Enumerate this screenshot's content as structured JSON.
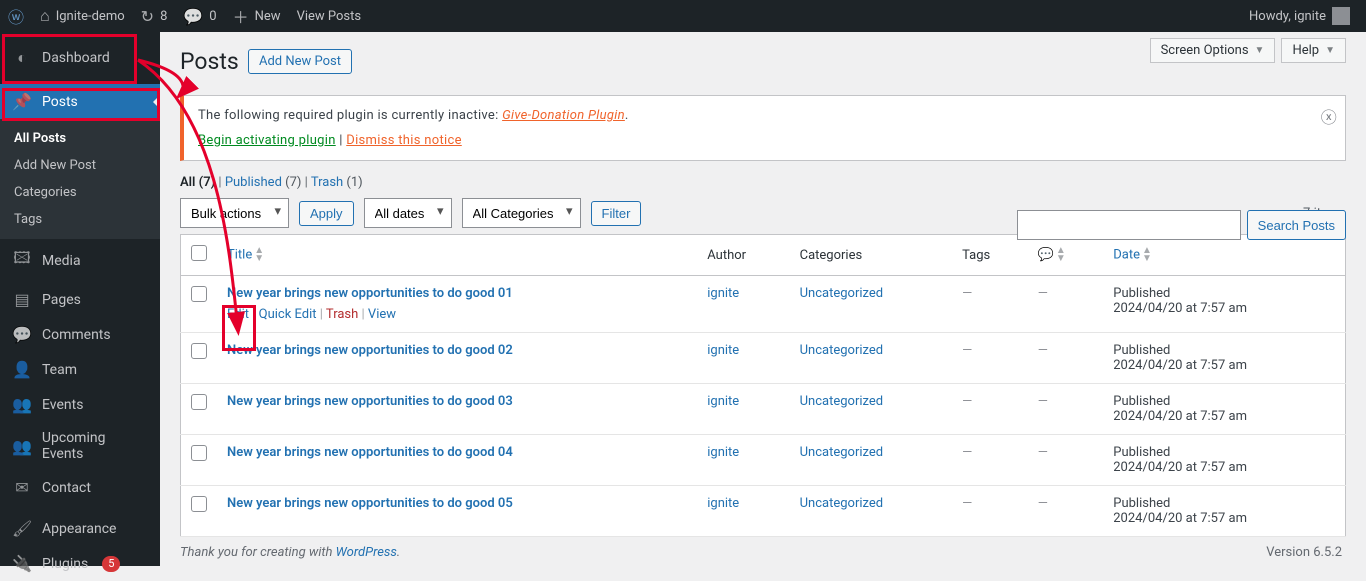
{
  "adminbar": {
    "site_name": "Ignite-demo",
    "updates_count": "8",
    "comments_count": "0",
    "new_label": "New",
    "view_posts": "View Posts",
    "howdy": "Howdy, ignite"
  },
  "sidebar": {
    "dashboard": "Dashboard",
    "posts": "Posts",
    "submenu": {
      "all_posts": "All Posts",
      "add_new": "Add New Post",
      "categories": "Categories",
      "tags": "Tags"
    },
    "media": "Media",
    "pages": "Pages",
    "comments": "Comments",
    "team": "Team",
    "events": "Events",
    "upcoming_events": "Upcoming Events",
    "contact": "Contact",
    "appearance": "Appearance",
    "plugins": "Plugins",
    "plugins_count": "5"
  },
  "top_buttons": {
    "screen_options": "Screen Options",
    "help": "Help"
  },
  "header": {
    "title": "Posts",
    "add_new": "Add New Post"
  },
  "notice": {
    "text_prefix": "The following required plugin is currently inactive: ",
    "plugin": "Give-Donation Plugin",
    "activate": "Begin activating plugin",
    "sep": " | ",
    "dismiss": "Dismiss this notice"
  },
  "filters": {
    "all": "All",
    "all_count": "(7)",
    "published": "Published",
    "published_count": "(7)",
    "trash": "Trash",
    "trash_count": "(1)"
  },
  "search": {
    "button": "Search Posts",
    "placeholder": ""
  },
  "bulk": {
    "bulk_actions": "Bulk actions",
    "apply": "Apply",
    "all_dates": "All dates",
    "all_categories": "All Categories",
    "filter": "Filter",
    "items": "7 items"
  },
  "columns": {
    "title": "Title",
    "author": "Author",
    "categories": "Categories",
    "tags": "Tags",
    "date": "Date"
  },
  "row_actions": {
    "edit": "Edit",
    "quick_edit": "Quick Edit",
    "trash": "Trash",
    "view": "View"
  },
  "rows": [
    {
      "title": "New year brings new opportunities to do good 01",
      "author": "ignite",
      "category": "Uncategorized",
      "tags": "—",
      "comments": "—",
      "status": "Published",
      "date": "2024/04/20 at 7:57 am",
      "show_actions": true
    },
    {
      "title": "New year brings new opportunities to do good 02",
      "author": "ignite",
      "category": "Uncategorized",
      "tags": "—",
      "comments": "—",
      "status": "Published",
      "date": "2024/04/20 at 7:57 am"
    },
    {
      "title": "New year brings new opportunities to do good 03",
      "author": "ignite",
      "category": "Uncategorized",
      "tags": "—",
      "comments": "—",
      "status": "Published",
      "date": "2024/04/20 at 7:57 am"
    },
    {
      "title": "New year brings new opportunities to do good 04",
      "author": "ignite",
      "category": "Uncategorized",
      "tags": "—",
      "comments": "—",
      "status": "Published",
      "date": "2024/04/20 at 7:57 am"
    },
    {
      "title": "New year brings new opportunities to do good 05",
      "author": "ignite",
      "category": "Uncategorized",
      "tags": "—",
      "comments": "—",
      "status": "Published",
      "date": "2024/04/20 at 7:57 am"
    }
  ],
  "footer": {
    "thank_prefix": "Thank you for creating with ",
    "wp": "WordPress",
    "version": "Version 6.5.2"
  }
}
